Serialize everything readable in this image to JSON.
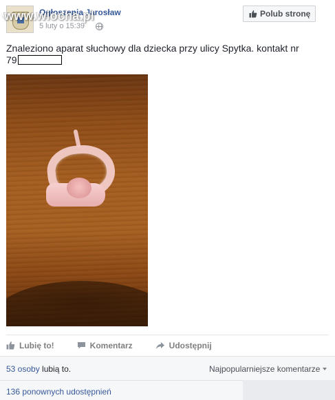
{
  "header": {
    "page_name": "Ogłoszenia Jarosław",
    "post_time": "5 luty o 15:39",
    "watermark": "www.wiocha.pl",
    "like_page_label": "Polub stronę"
  },
  "post": {
    "text_line1": "Znaleziono aparat słuchowy dla dziecka przy ulicy Spytka. kontakt nr",
    "text_line2_prefix": "79"
  },
  "actions": {
    "like_label": "Lubię to!",
    "comment_label": "Komentarz",
    "share_label": "Udostępnij"
  },
  "footer": {
    "likes_count": "53 osoby",
    "likes_suffix": "lubią to.",
    "sort_label": "Najpopularniejsze komentarze",
    "shares_count": "136 ponownych udostępnień"
  },
  "icons": {
    "thumb": "thumbs-up-icon",
    "comment": "comment-icon",
    "share": "share-arrow-icon",
    "globe": "globe-icon",
    "caret": "caret-down-icon"
  },
  "colors": {
    "link": "#365899",
    "muted": "#90949c",
    "action": "#7f7f7f",
    "footer_bg": "#f6f7f9"
  }
}
